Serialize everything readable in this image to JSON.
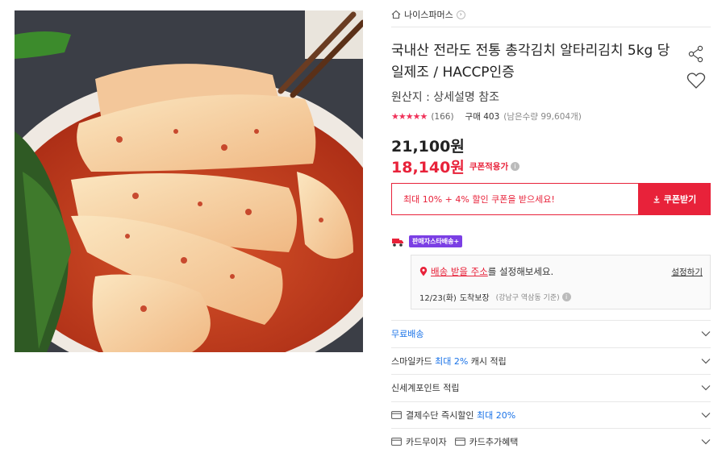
{
  "seller": {
    "name": "나이스파머스"
  },
  "product": {
    "title": "국내산 전라도 전통 총각김치 알타리김치 5kg 당일제조 / HACCP인증",
    "origin": "원산지 : 상세설명 참조",
    "rating": {
      "stars": "★★★★★",
      "review_count": "(166)",
      "purchases": "구매 403",
      "remaining": "(남은수량 99,604개)"
    },
    "original_price": "21,100원",
    "sale_price": "18,140원",
    "coupon_applied": "쿠폰적용가",
    "coupon_message": "최대 10% + 4% 할인 쿠폰을 받으세요!",
    "coupon_button": "쿠폰받기"
  },
  "delivery": {
    "badge": "판매자스타배송+",
    "address_link": "배송 받을 주소",
    "address_suffix": "를 설정해보세요.",
    "set_button": "설정하기",
    "eta_prefix": "12/23(화)",
    "eta_suffix": "도착보장",
    "eta_location": "(강남구 역삼동 기준)"
  },
  "benefits": {
    "free_shipping": "무료배송",
    "smilecard_prefix": "스마일카드",
    "smilecard_highlight": "최대 2%",
    "smilecard_suffix": "캐시 적립",
    "shinsegae": "신세계포인트 적립",
    "payment_prefix": "결제수단 즉시할인",
    "payment_highlight": "최대 20%",
    "installment": "카드무이자",
    "card_extra": "카드추가혜택"
  },
  "colors": {
    "accent": "#e8223a",
    "link_blue": "#1a73e8",
    "badge_purple": "#7b3fe4"
  },
  "icons": [
    "home-icon",
    "share-icon",
    "heart-icon",
    "truck-icon",
    "pin-icon",
    "info-icon",
    "download-icon",
    "chevron-down-icon",
    "card-icon"
  ]
}
